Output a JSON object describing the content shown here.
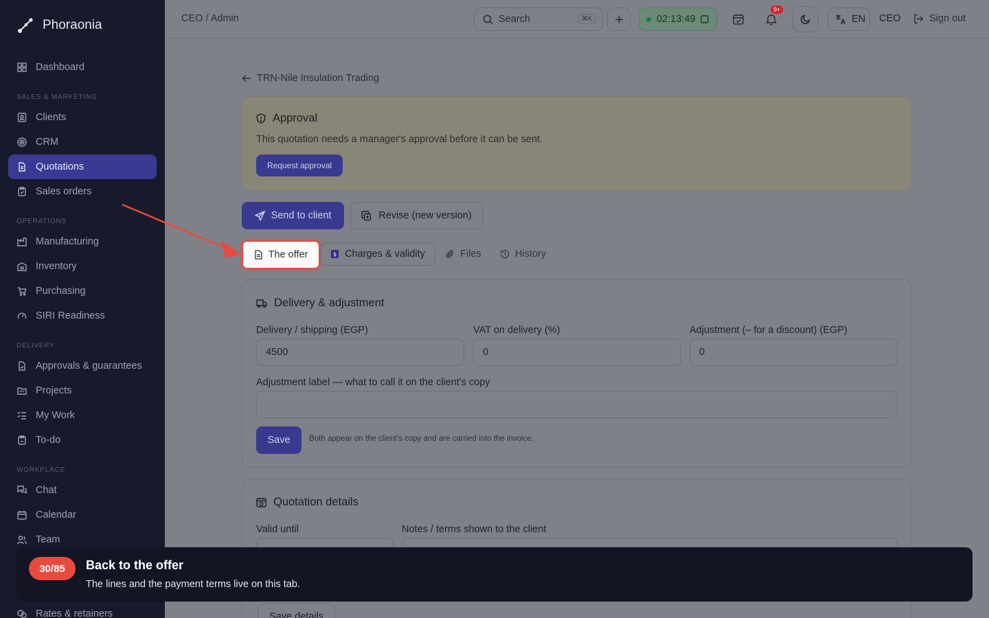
{
  "app": {
    "name": "Phoraonia"
  },
  "sidebar": {
    "items": [
      {
        "label": "Dashboard",
        "icon": "grid-icon"
      },
      {
        "label": "Clients",
        "icon": "contact-icon"
      },
      {
        "label": "CRM",
        "icon": "target-icon"
      },
      {
        "label": "Quotations",
        "icon": "file-icon",
        "active": true
      },
      {
        "label": "Sales orders",
        "icon": "clipboard-icon"
      },
      {
        "label": "Manufacturing",
        "icon": "factory-icon"
      },
      {
        "label": "Inventory",
        "icon": "warehouse-icon"
      },
      {
        "label": "Purchasing",
        "icon": "cart-icon"
      },
      {
        "label": "SIRI Readiness",
        "icon": "gauge-icon"
      },
      {
        "label": "Approvals & guarantees",
        "icon": "file-check-icon"
      },
      {
        "label": "Projects",
        "icon": "folder-icon"
      },
      {
        "label": "My Work",
        "icon": "list-check-icon"
      },
      {
        "label": "To-do",
        "icon": "checkbox-icon"
      },
      {
        "label": "Chat",
        "icon": "chat-icon"
      },
      {
        "label": "Calendar",
        "icon": "calendar-icon"
      },
      {
        "label": "Team",
        "icon": "users-icon"
      },
      {
        "label": "Rates & retainers",
        "icon": "coins-icon"
      }
    ],
    "sections": [
      "SALES & MARKETING",
      "OPERATIONS",
      "DELIVERY",
      "WORKPLACE"
    ]
  },
  "topbar": {
    "breadcrumb": "CEO / Admin",
    "search_label": "Search",
    "search_kbd": "⌘K",
    "timer": "02:13:49",
    "notif_badge": "9+",
    "lang": "EN",
    "role": "CEO",
    "signout": "Sign out"
  },
  "page": {
    "back_label": "TRN-Nile Insulation Trading",
    "approval": {
      "title": "Approval",
      "text": "This quotation needs a manager's approval before it can be sent.",
      "button": "Request approval"
    },
    "actions": {
      "send": "Send to client",
      "revise": "Revise (new version)"
    },
    "tabs": [
      "The offer",
      "Charges & validity",
      "Files",
      "History"
    ],
    "delivery": {
      "title": "Delivery & adjustment",
      "fields": [
        {
          "label": "Delivery / shipping (EGP)",
          "value": "4500"
        },
        {
          "label": "VAT on delivery (%)",
          "value": "0"
        },
        {
          "label": "Adjustment (– for a discount) (EGP)",
          "value": "0"
        }
      ],
      "adj_label": "Adjustment label — what to call it on the client's copy",
      "adj_value": "",
      "save": "Save",
      "hint": "Both appear on the client's copy and are carried into the invoice."
    },
    "details": {
      "title": "Quotation details",
      "valid_label": "Valid until",
      "notes_label": "Notes / terms shown to the client",
      "save": "Save details"
    }
  },
  "tour": {
    "step": "30/85",
    "title": "Back to the offer",
    "text": "The lines and the payment terms live on this tab."
  },
  "colors": {
    "accent": "#3a3a94",
    "highlight": "#e94a3e",
    "sidebar": "#171a2b"
  }
}
